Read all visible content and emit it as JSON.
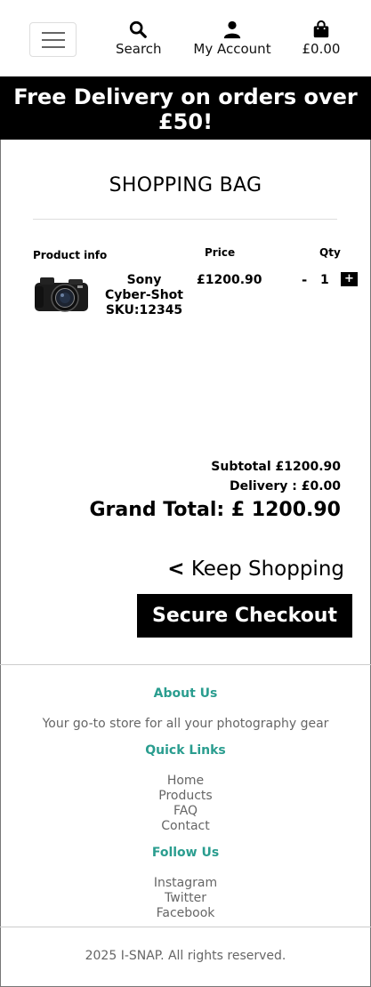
{
  "header": {
    "search_label": "Search",
    "account_label": "My Account",
    "bag_total": "£0.00"
  },
  "promo": {
    "text": "Free Delivery on orders over £50!"
  },
  "bag": {
    "title": "SHOPPING BAG",
    "columns": {
      "product": "Product info",
      "price": "Price",
      "qty": "Qty"
    },
    "items": [
      {
        "name": "Sony Cyber-Shot SKU:12345",
        "price": "£1200.90",
        "minus": "-",
        "quantity": "1",
        "plus": "+"
      }
    ],
    "subtotal": "Subtotal £1200.90",
    "delivery": "Delivery : £0.00",
    "grand_total": "Grand Total: £ 1200.90",
    "keep_shopping_arrow": "<",
    "keep_shopping": "Keep Shopping",
    "checkout": "Secure Checkout"
  },
  "footer": {
    "about_heading": "About Us",
    "about_text": "Your go-to store for all your photography gear",
    "quick_heading": "Quick Links",
    "quick_links": [
      "Home",
      "Products",
      "FAQ",
      "Contact"
    ],
    "follow_heading": "Follow Us",
    "social_links": [
      "Instagram",
      "Twitter",
      "Facebook"
    ],
    "copyright": "2025 I-SNAP. All rights reserved."
  },
  "colors": {
    "accent": "#2a9d8f",
    "promo_bg": "#000000",
    "checkout_bg": "#000000"
  },
  "icons": [
    "menu-icon",
    "search-icon",
    "user-icon",
    "shopping-bag-icon",
    "camera-product-image"
  ]
}
